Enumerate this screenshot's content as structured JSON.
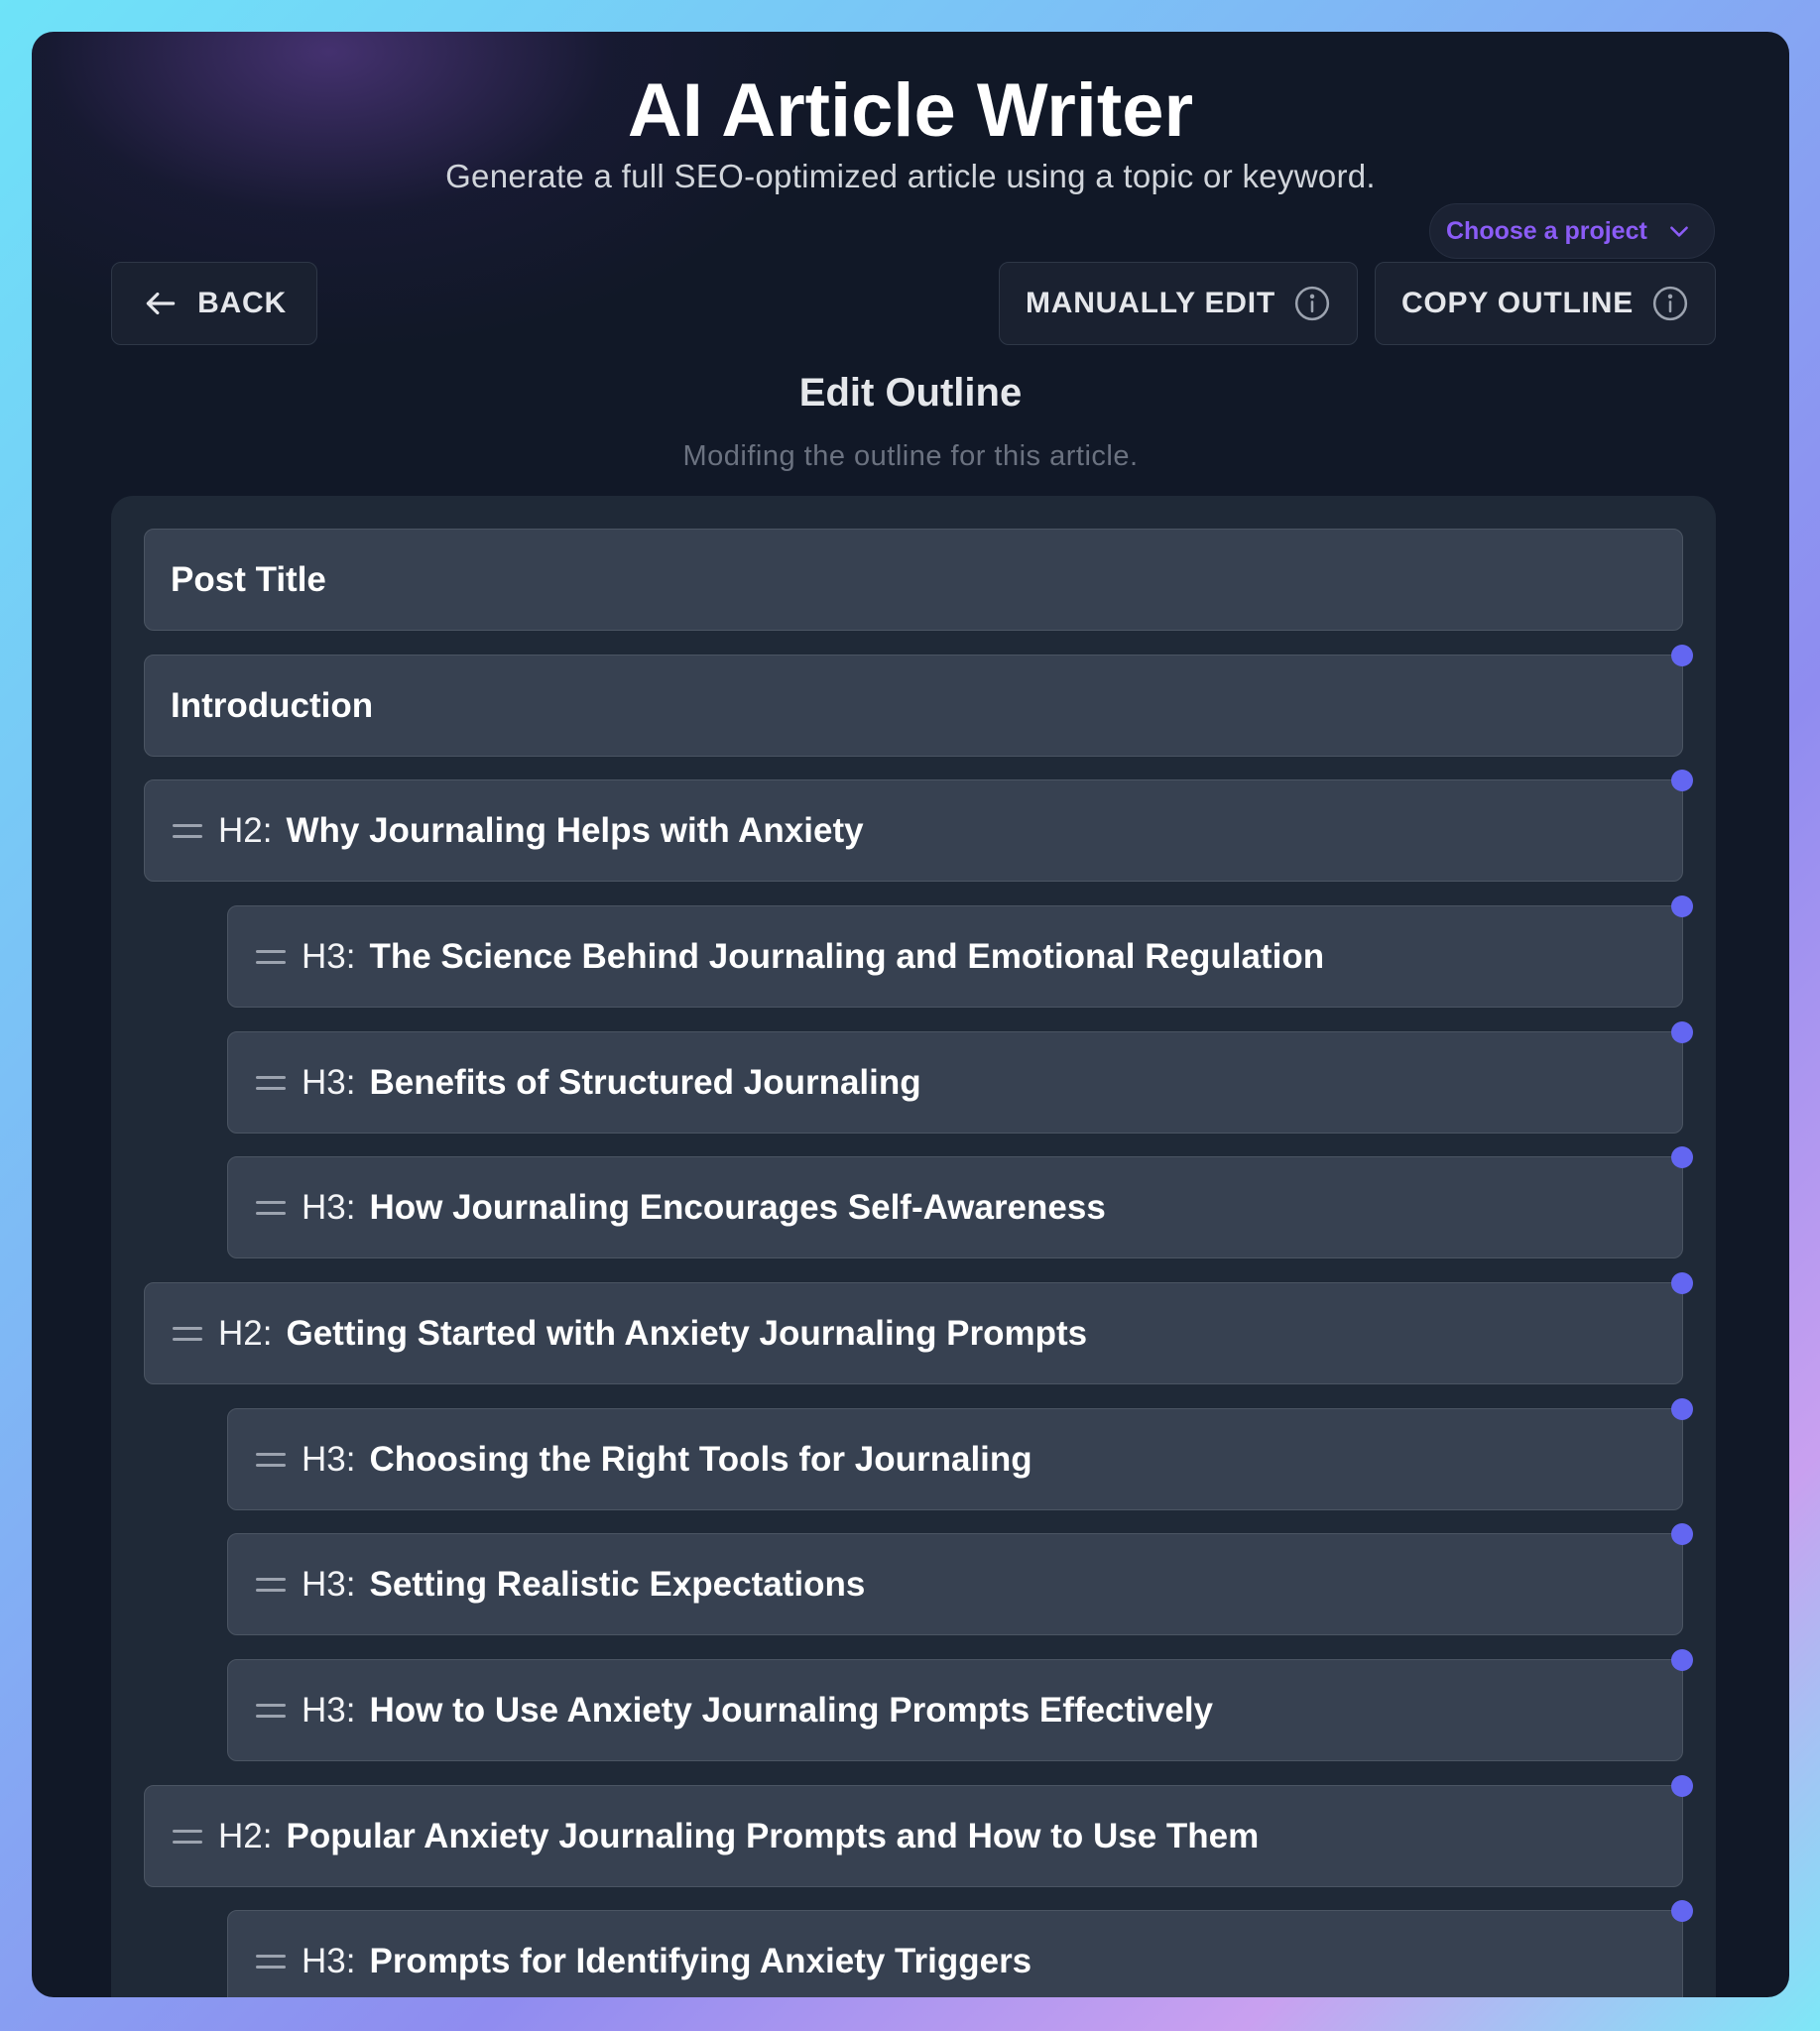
{
  "header": {
    "title": "AI Article Writer",
    "subtitle": "Generate a full SEO-optimized article using a topic or keyword."
  },
  "project_select": {
    "value": "Choose a project"
  },
  "toolbar": {
    "back_label": "BACK",
    "manually_edit_label": "MANUALLY EDIT",
    "copy_outline_label": "COPY OUTLINE"
  },
  "outline": {
    "title": "Edit Outline",
    "subtitle": "Modifing the outline for this article.",
    "post_title_label": "Post Title",
    "introduction_label": "Introduction",
    "headings": [
      {
        "level": "H2:",
        "text": "Why Journaling Helps with Anxiety"
      },
      {
        "level": "H3:",
        "text": "The Science Behind Journaling and Emotional Regulation"
      },
      {
        "level": "H3:",
        "text": "Benefits of Structured Journaling"
      },
      {
        "level": "H3:",
        "text": "How Journaling Encourages Self-Awareness"
      },
      {
        "level": "H2:",
        "text": "Getting Started with Anxiety Journaling Prompts"
      },
      {
        "level": "H3:",
        "text": "Choosing the Right Tools for Journaling"
      },
      {
        "level": "H3:",
        "text": "Setting Realistic Expectations"
      },
      {
        "level": "H3:",
        "text": "How to Use Anxiety Journaling Prompts Effectively"
      },
      {
        "level": "H2:",
        "text": "Popular Anxiety Journaling Prompts and How to Use Them"
      },
      {
        "level": "H3:",
        "text": "Prompts for Identifying Anxiety Triggers"
      }
    ]
  },
  "colors": {
    "accent": "#6366f1",
    "select_text": "#8b5cf6",
    "row_bg": "#374151",
    "panel_bg": "#1f2937",
    "window_bg": "#111827"
  }
}
